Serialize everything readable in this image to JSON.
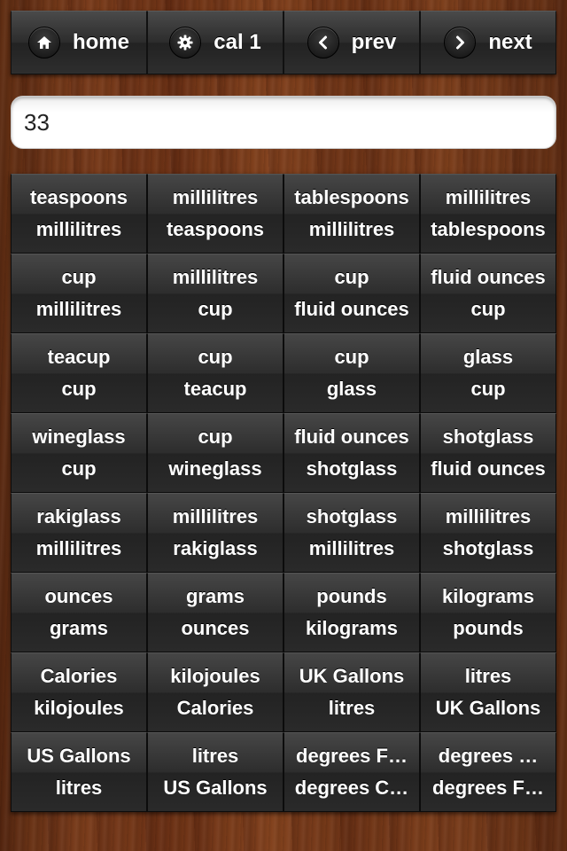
{
  "toolbar": {
    "home_label": "home",
    "calc_label": "cal 1",
    "prev_label": "prev",
    "next_label": "next"
  },
  "input": {
    "value": "33"
  },
  "conversions": [
    {
      "from": "teaspoons",
      "to": "millilitres"
    },
    {
      "from": "millilitres",
      "to": "teaspoons"
    },
    {
      "from": "tablespoons",
      "to": "millilitres"
    },
    {
      "from": "millilitres",
      "to": "tablespoons"
    },
    {
      "from": "cup",
      "to": "millilitres"
    },
    {
      "from": "millilitres",
      "to": "cup"
    },
    {
      "from": "cup",
      "to": "fluid ounces"
    },
    {
      "from": "fluid ounces",
      "to": "cup"
    },
    {
      "from": "teacup",
      "to": "cup"
    },
    {
      "from": "cup",
      "to": "teacup"
    },
    {
      "from": "cup",
      "to": "glass"
    },
    {
      "from": "glass",
      "to": "cup"
    },
    {
      "from": "wineglass",
      "to": "cup"
    },
    {
      "from": "cup",
      "to": "wineglass"
    },
    {
      "from": "fluid ounces",
      "to": "shotglass"
    },
    {
      "from": "shotglass",
      "to": "fluid ounces"
    },
    {
      "from": "rakiglass",
      "to": "millilitres"
    },
    {
      "from": "millilitres",
      "to": "rakiglass"
    },
    {
      "from": "shotglass",
      "to": "millilitres"
    },
    {
      "from": "millilitres",
      "to": "shotglass"
    },
    {
      "from": "ounces",
      "to": "grams"
    },
    {
      "from": "grams",
      "to": "ounces"
    },
    {
      "from": "pounds",
      "to": "kilograms"
    },
    {
      "from": "kilograms",
      "to": "pounds"
    },
    {
      "from": "Calories",
      "to": "kilojoules"
    },
    {
      "from": "kilojoules",
      "to": "Calories"
    },
    {
      "from": "UK Gallons",
      "to": "litres"
    },
    {
      "from": "litres",
      "to": "UK Gallons"
    },
    {
      "from": "US Gallons",
      "to": "litres"
    },
    {
      "from": "litres",
      "to": "US Gallons"
    },
    {
      "from": "degrees F…",
      "to": "degrees C…"
    },
    {
      "from": "degrees …",
      "to": "degrees F…"
    }
  ]
}
